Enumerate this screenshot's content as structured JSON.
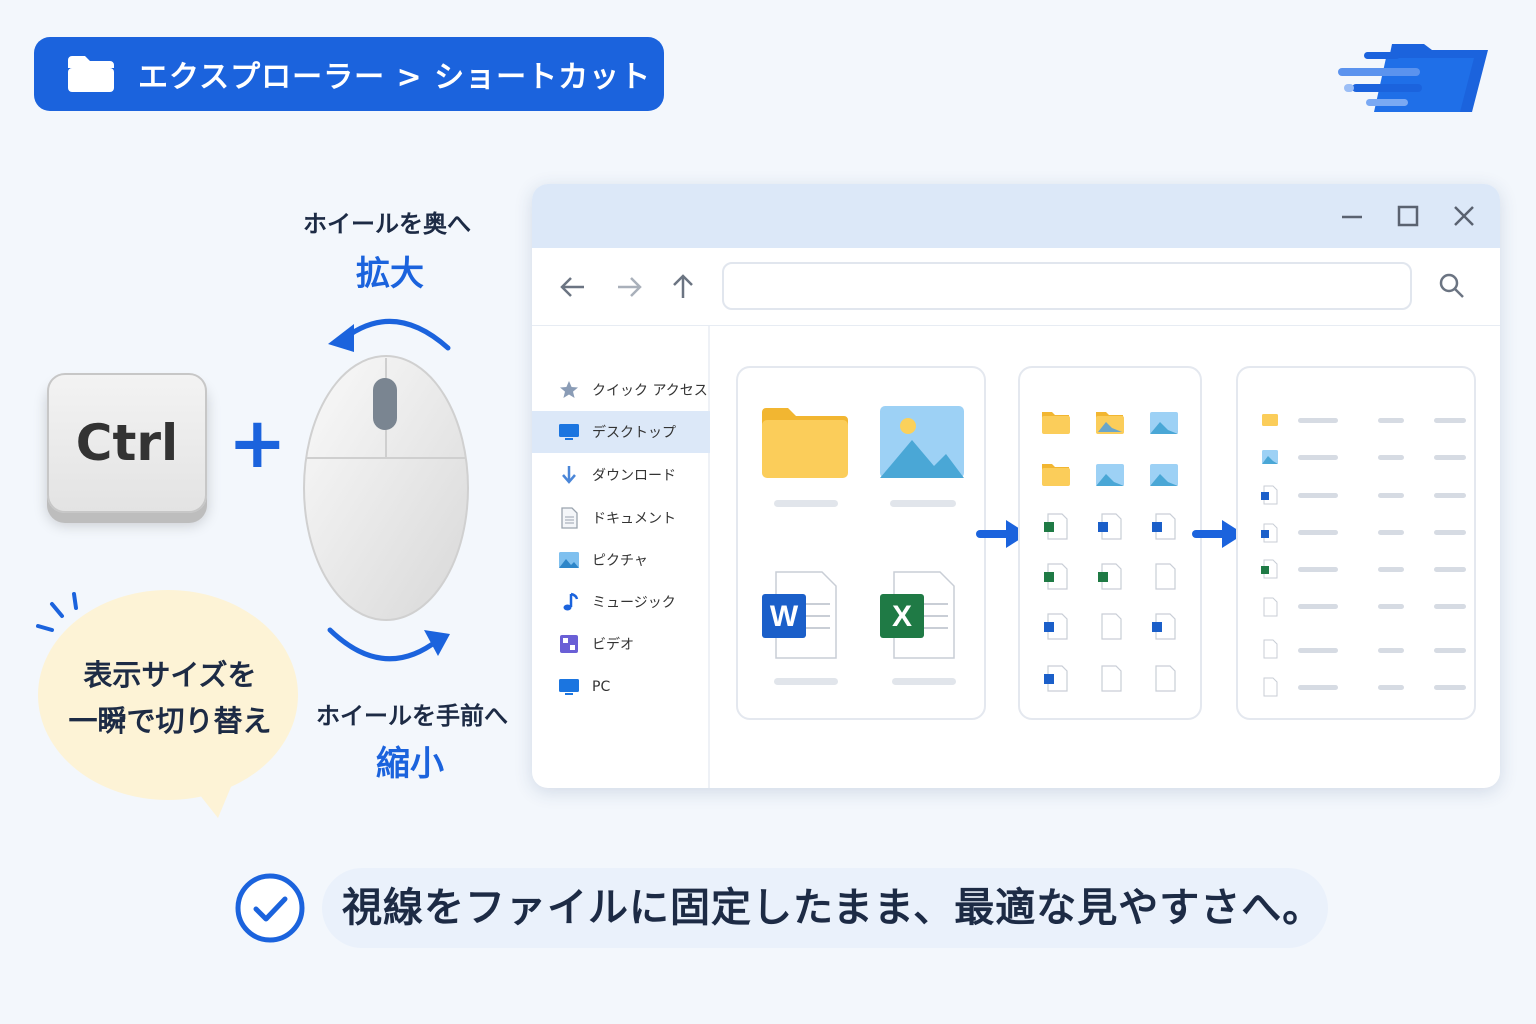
{
  "header": {
    "title": "エクスプローラー > ショートカット"
  },
  "shortcut": {
    "key": "Ctrl",
    "plus": "+",
    "wheel_up": "ホイールを奥へ",
    "zoom_in": "拡大",
    "wheel_down": "ホイールを手前へ",
    "zoom_out": "縮小"
  },
  "bubble": {
    "line1": "表示サイズを",
    "line2": "一瞬で切り替え"
  },
  "explorer": {
    "sidebar": [
      {
        "label": "クイック アクセス",
        "icon": "star-icon"
      },
      {
        "label": "デスクトップ",
        "icon": "desktop-icon",
        "active": true
      },
      {
        "label": "ダウンロード",
        "icon": "download-icon"
      },
      {
        "label": "ドキュメント",
        "icon": "document-icon"
      },
      {
        "label": "ピクチャ",
        "icon": "picture-icon"
      },
      {
        "label": "ミュージック",
        "icon": "music-icon"
      },
      {
        "label": "ビデオ",
        "icon": "video-icon"
      },
      {
        "label": "PC",
        "icon": "pc-icon"
      }
    ],
    "large_view": {
      "word_letter": "W",
      "excel_letter": "X"
    }
  },
  "footer": {
    "message": "視線をファイルに固定したまま、最適な見やすさへ。"
  },
  "colors": {
    "accent": "#1b63dd",
    "bubble": "#fdf3d6",
    "folder": "#fbcd5a"
  }
}
